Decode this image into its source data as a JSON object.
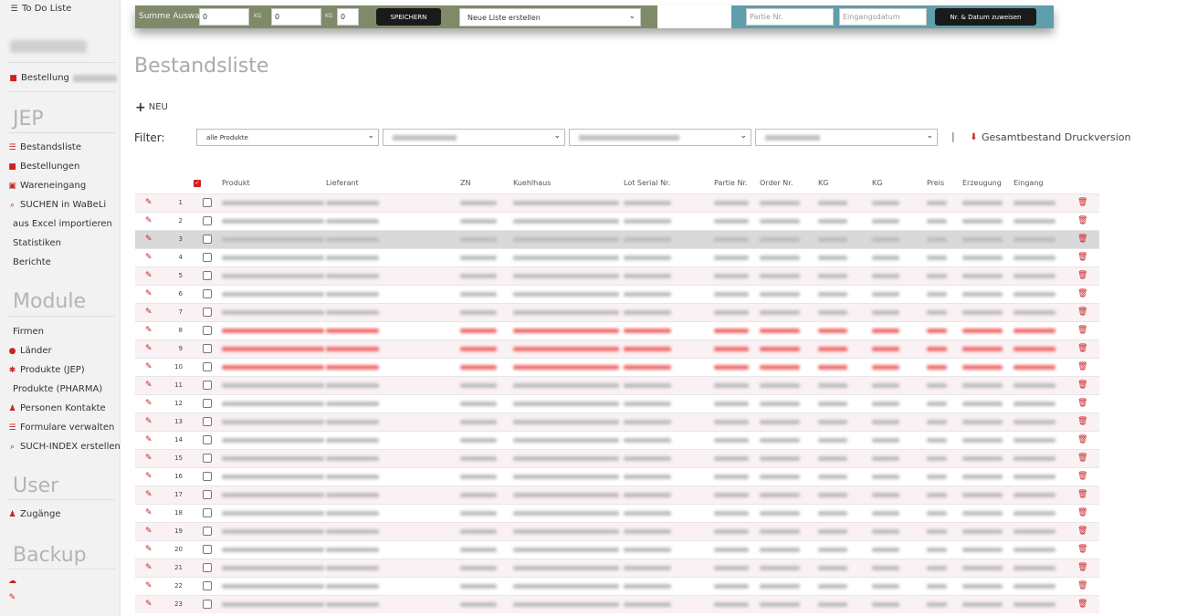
{
  "sidebar": {
    "todo_label": "To Do Liste",
    "bestellung_label": "Bestellung",
    "sections": {
      "jep": "JEP",
      "module": "Module",
      "user": "User",
      "backup": "Backup"
    },
    "jep_items": [
      {
        "label": "Bestandsliste",
        "icon": "list-icon"
      },
      {
        "label": "Bestellungen",
        "icon": "truck-icon"
      },
      {
        "label": "Wareneingang",
        "icon": "inbox-icon"
      },
      {
        "label": "SUCHEN in WaBeLi",
        "icon": "search-icon"
      },
      {
        "label": "aus Excel importieren",
        "icon": ""
      },
      {
        "label": "Statistiken",
        "icon": ""
      },
      {
        "label": "Berichte",
        "icon": ""
      }
    ],
    "module_items": [
      {
        "label": "Firmen",
        "icon": ""
      },
      {
        "label": "Länder",
        "icon": "globe-icon"
      },
      {
        "label": "Produkte (JEP)",
        "icon": "gear-icon"
      },
      {
        "label": "Produkte (PHARMA)",
        "icon": ""
      },
      {
        "label": "Personen Kontakte",
        "icon": "users-icon"
      },
      {
        "label": "Formulare verwalten",
        "icon": "list-icon"
      },
      {
        "label": "SUCH-INDEX erstellen",
        "icon": "search-icon"
      }
    ],
    "user_items": [
      {
        "label": "Zugänge",
        "icon": "user-icon"
      }
    ]
  },
  "toolbar": {
    "summe_label": "Summe Auswahl",
    "input1_value": "0",
    "unit1": "KG",
    "input2_value": "0",
    "unit2": "KG",
    "input3_value": "0",
    "save_label": "SPEICHERN",
    "list_select_value": "Neue Liste erstellen",
    "partie_placeholder": "Partie Nr.",
    "eingangsdatum_placeholder": "Eingangsdatum",
    "assign_label": "Nr. & Datum zuweisen",
    "colors": {
      "green": "#7f8a69",
      "blue": "#5f9eab",
      "button": "#1a1a1a"
    }
  },
  "page": {
    "title": "Bestandsliste",
    "new_label": "NEU",
    "filter_label": "Filter:",
    "filter1_value": "alle Produkte",
    "print_label": "Gesamtbestand Druckversion",
    "pipe": "|"
  },
  "table": {
    "columns": [
      "Produkt",
      "Lieferant",
      "ZN",
      "Kuehlhaus",
      "Lot Serial Nr.",
      "Partie Nr.",
      "Order Nr.",
      "KG",
      "KG",
      "Preis",
      "Erzeugung",
      "Eingang"
    ],
    "rows": [
      "1",
      "2",
      "3",
      "4",
      "5",
      "6",
      "7",
      "8",
      "9",
      "10",
      "11",
      "12",
      "13",
      "14",
      "15",
      "16",
      "17",
      "18",
      "19",
      "20",
      "21",
      "22",
      "23"
    ],
    "highlighted_row": "3",
    "red_rows": [
      "8",
      "9",
      "10"
    ],
    "accent_color": "#cc2222"
  }
}
